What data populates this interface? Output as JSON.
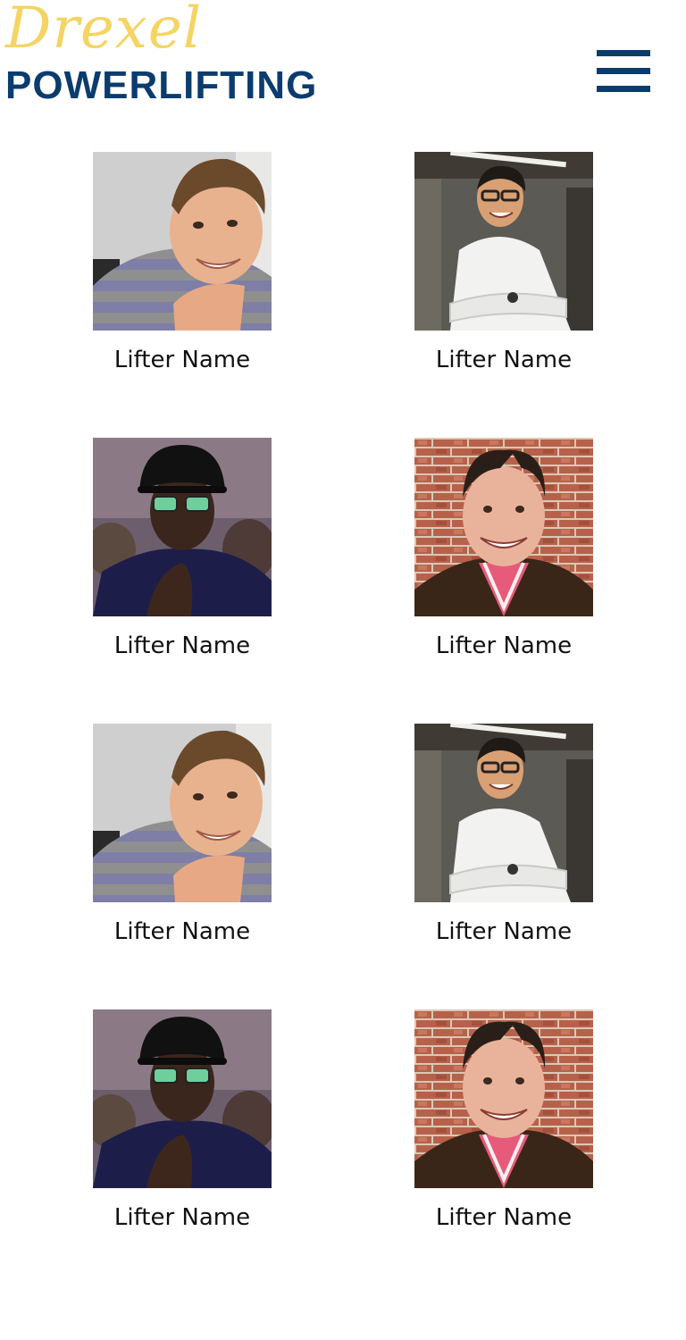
{
  "header": {
    "logo_script": "Drexel",
    "logo_word": "POWERLIFTING",
    "menu_icon": "hamburger-menu-icon",
    "brand_colors": {
      "gold": "#f5d463",
      "navy": "#0a3c6e"
    }
  },
  "lifters": [
    {
      "name": "Lifter Name",
      "photo": "portrait-young-man-striped-sweater"
    },
    {
      "name": "Lifter Name",
      "photo": "portrait-man-white-shirt-glasses"
    },
    {
      "name": "Lifter Name",
      "photo": "portrait-man-hat-glasses"
    },
    {
      "name": "Lifter Name",
      "photo": "portrait-man-brick-wall"
    },
    {
      "name": "Lifter Name",
      "photo": "portrait-young-man-striped-sweater"
    },
    {
      "name": "Lifter Name",
      "photo": "portrait-man-white-shirt-glasses"
    },
    {
      "name": "Lifter Name",
      "photo": "portrait-man-hat-glasses"
    },
    {
      "name": "Lifter Name",
      "photo": "portrait-man-brick-wall"
    }
  ]
}
